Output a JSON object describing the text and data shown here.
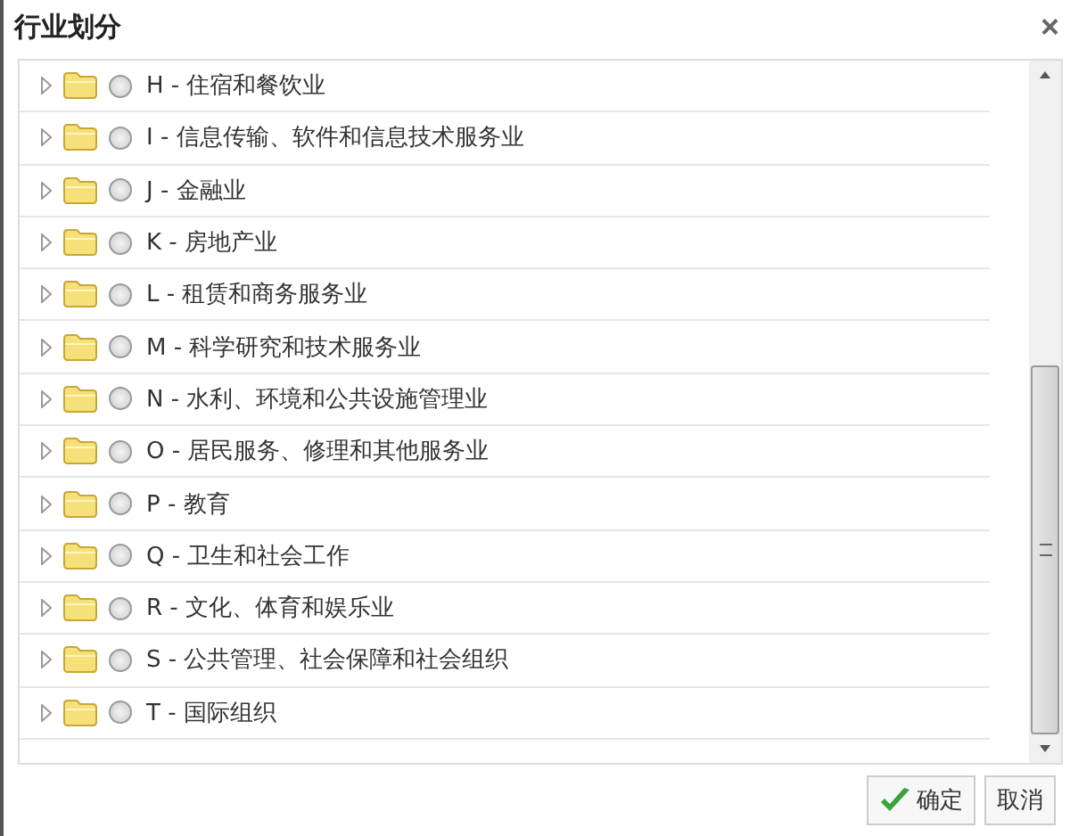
{
  "window": {
    "title": "行业划分",
    "close": "×"
  },
  "items": [
    {
      "label": "H - 住宿和餐饮业",
      "selected": false
    },
    {
      "label": "I - 信息传输、软件和信息技术服务业",
      "selected": false
    },
    {
      "label": "J - 金融业",
      "selected": false
    },
    {
      "label": "K - 房地产业",
      "selected": false
    },
    {
      "label": "L - 租赁和商务服务业",
      "selected": false
    },
    {
      "label": "M - 科学研究和技术服务业",
      "selected": false
    },
    {
      "label": "N - 水利、环境和公共设施管理业",
      "selected": false
    },
    {
      "label": "O - 居民服务、修理和其他服务业",
      "selected": false
    },
    {
      "label": "P - 教育",
      "selected": false
    },
    {
      "label": "Q - 卫生和社会工作",
      "selected": false
    },
    {
      "label": "R - 文化、体育和娱乐业",
      "selected": false
    },
    {
      "label": "S - 公共管理、社会保障和社会组织",
      "selected": false
    },
    {
      "label": "T - 国际组织",
      "selected": false
    }
  ],
  "buttons": [
    {
      "label": "确定",
      "kind": "confirm"
    },
    {
      "label": "取消",
      "kind": "cancel"
    }
  ]
}
